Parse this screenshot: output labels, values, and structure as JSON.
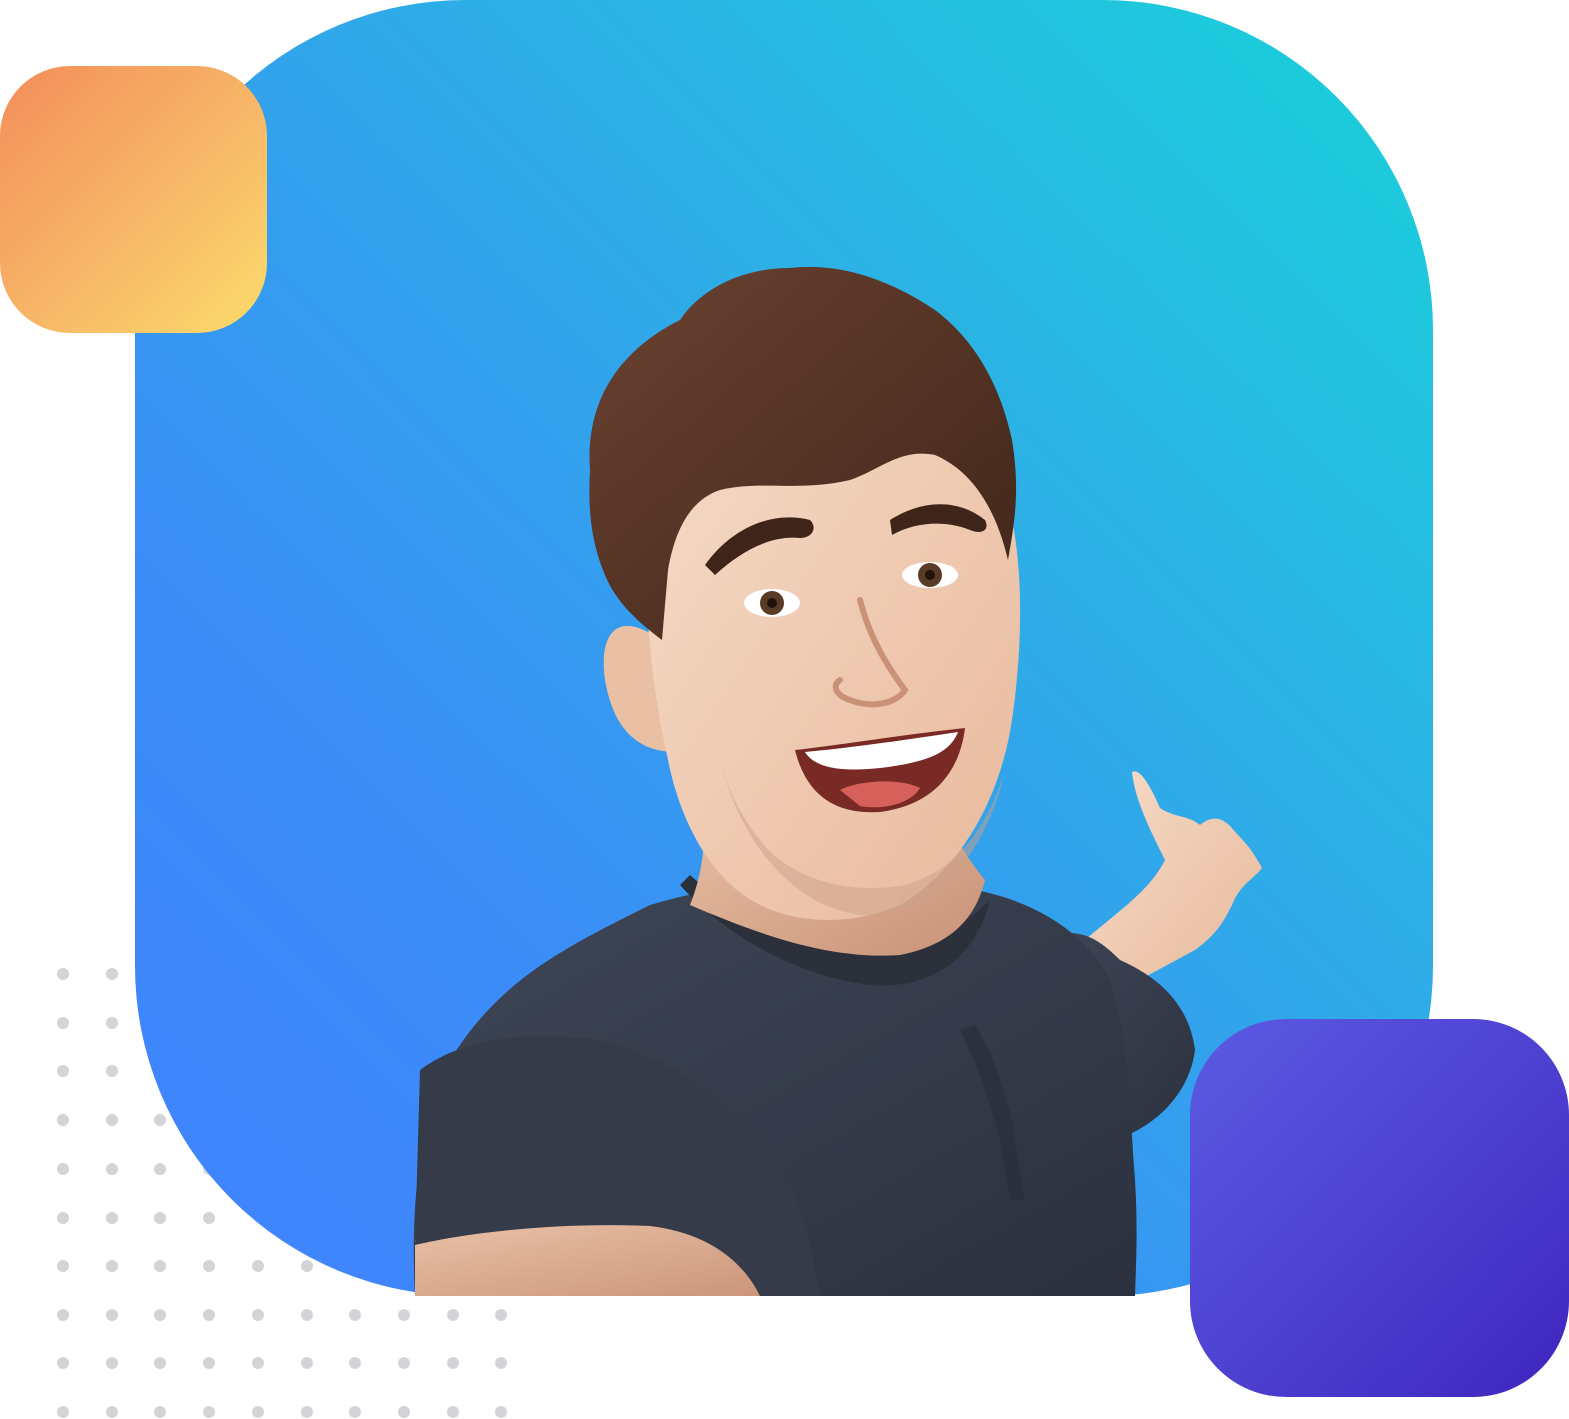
{
  "colors": {
    "card_gradient_start": "#4182ff",
    "card_gradient_end": "#18d2d8",
    "orange_frame_start": "#f48d5b",
    "orange_frame_end": "#fbdc6b",
    "purple_block_start": "#5b5be3",
    "purple_block_end": "#3e25bd",
    "dot_color": "#d4d4d8",
    "shirt_color": "#363d4c",
    "hair_color": "#5a3526"
  },
  "illustration": {
    "subject": "smiling-man-selfie",
    "decorations": [
      "orange-square-frame",
      "purple-rounded-square",
      "dot-grid"
    ]
  }
}
